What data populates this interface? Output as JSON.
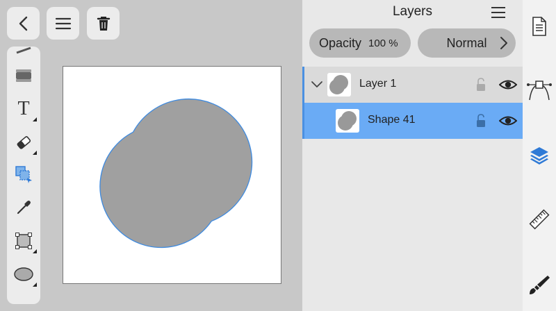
{
  "toolbar": {
    "back": "back",
    "menu": "menu",
    "delete": "delete"
  },
  "tools": [
    {
      "name": "pen-tool-icon"
    },
    {
      "name": "fill-tool-icon"
    },
    {
      "name": "text-tool-icon",
      "glyph": "T"
    },
    {
      "name": "eraser-tool-icon"
    },
    {
      "name": "selection-tool-icon",
      "active": true
    },
    {
      "name": "eyedropper-tool-icon"
    },
    {
      "name": "transform-tool-icon"
    },
    {
      "name": "ellipse-tool-icon"
    }
  ],
  "layers_panel": {
    "title": "Layers",
    "opacity_label": "Opacity",
    "opacity_value": "100 %",
    "blend_mode": "Normal",
    "rows": [
      {
        "label": "Layer 1",
        "expanded": true,
        "selected": false
      },
      {
        "label": "Shape 41",
        "selected": true
      }
    ]
  },
  "colors": {
    "accent": "#4a90e2",
    "selected_row": "#6aabf5",
    "shape_fill": "#a0a0a0",
    "shape_stroke": "#3d8ae0"
  },
  "sidebar": [
    "document-icon",
    "vector-path-icon",
    "layers-icon",
    "ruler-icon",
    "brush-icon"
  ]
}
